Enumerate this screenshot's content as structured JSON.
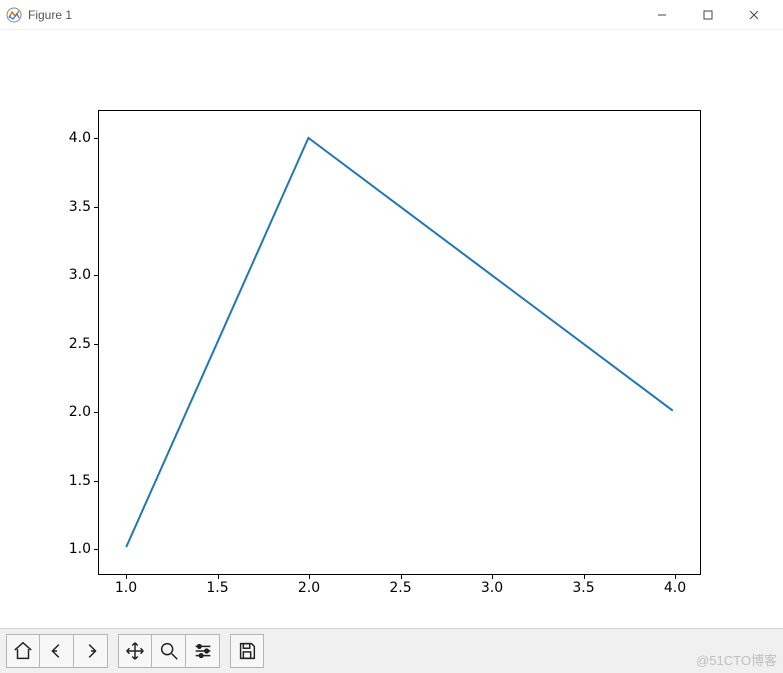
{
  "window": {
    "title": "Figure 1",
    "controls": {
      "minimize": "minimize-button",
      "maximize": "maximize-button",
      "close": "close-button"
    }
  },
  "chart_data": {
    "type": "line",
    "x": [
      1.0,
      2.0,
      3.0,
      4.0
    ],
    "y": [
      1.0,
      4.0,
      3.0,
      2.0
    ],
    "title": "",
    "xlabel": "",
    "ylabel": "",
    "xlim": [
      1.0,
      4.0
    ],
    "ylim": [
      1.0,
      4.0
    ],
    "xticks": [
      "1.0",
      "1.5",
      "2.0",
      "2.5",
      "3.0",
      "3.5",
      "4.0"
    ],
    "yticks": [
      "1.0",
      "1.5",
      "2.0",
      "2.5",
      "3.0",
      "3.5",
      "4.0"
    ],
    "line_color": "#1f77b4"
  },
  "toolbar": {
    "home": "Home",
    "back": "Back",
    "forward": "Forward",
    "pan": "Pan",
    "zoom": "Zoom",
    "configure": "Configure subplots",
    "save": "Save"
  },
  "watermark": "@51CTO博客"
}
